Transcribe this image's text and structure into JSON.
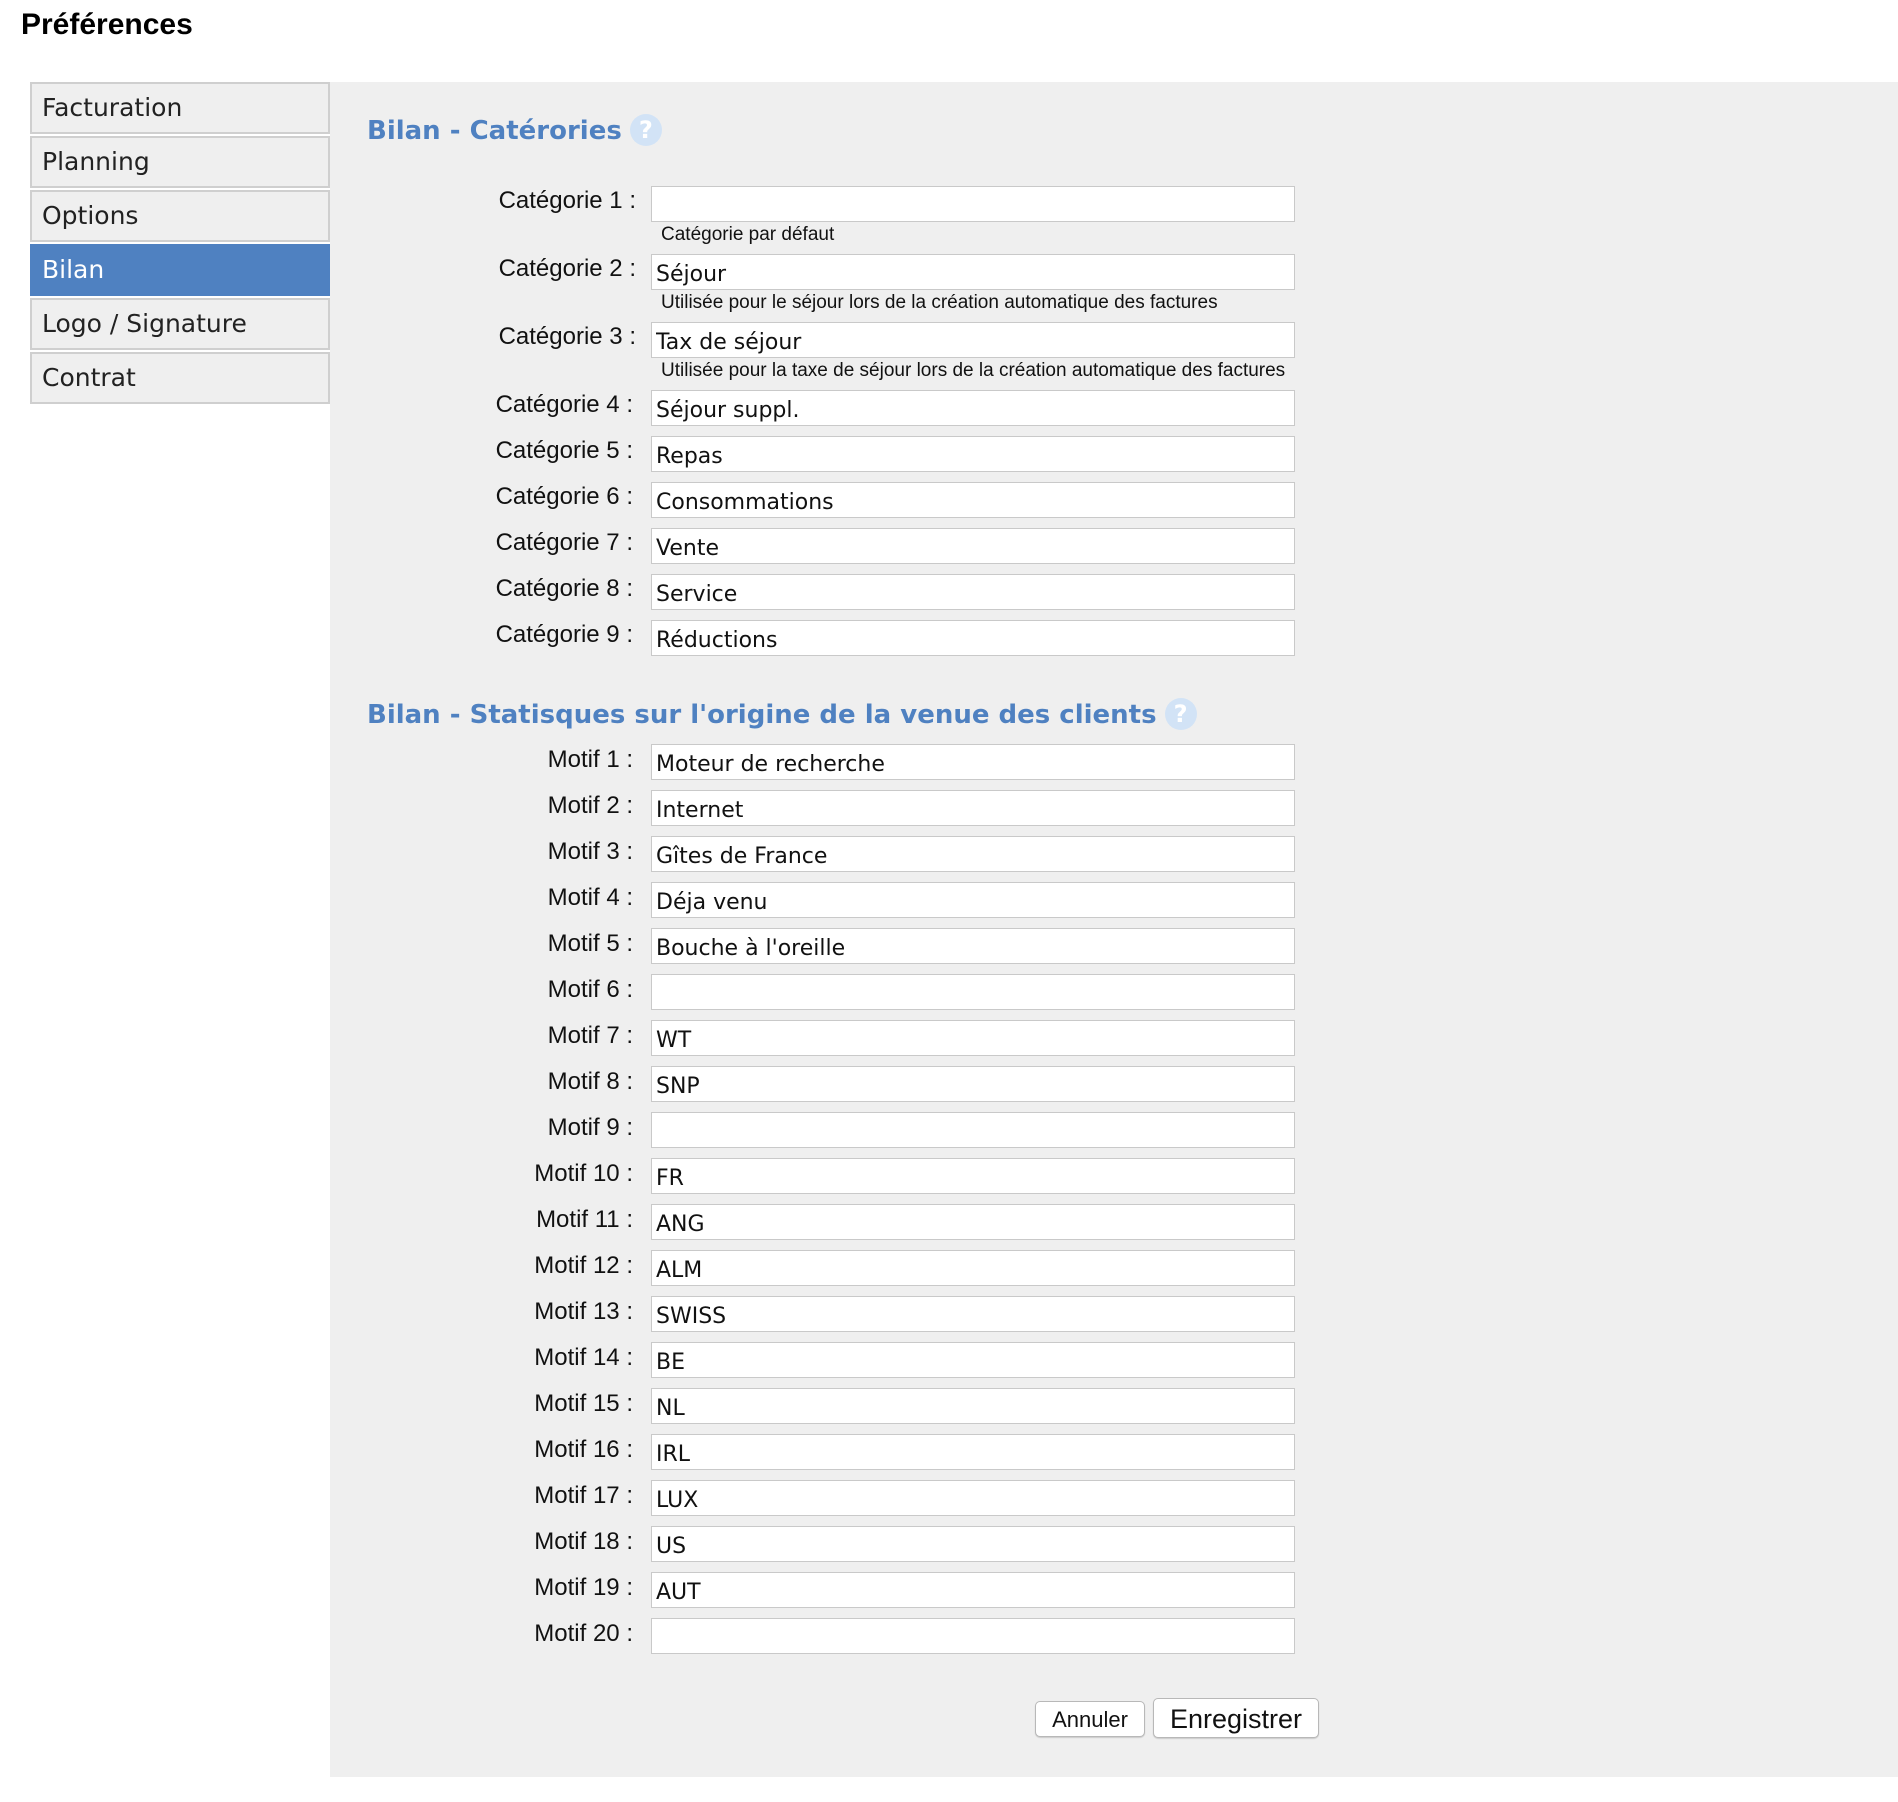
{
  "page": {
    "title": "Préférences"
  },
  "sidebar": {
    "items": [
      {
        "label": "Facturation",
        "active": false
      },
      {
        "label": "Planning",
        "active": false
      },
      {
        "label": "Options",
        "active": false
      },
      {
        "label": "Bilan",
        "active": true
      },
      {
        "label": "Logo / Signature",
        "active": false
      },
      {
        "label": "Contrat",
        "active": false
      }
    ]
  },
  "colors": {
    "accent": "#4f81c1",
    "panel_bg": "#efefef",
    "help_icon": "#d2e3f6"
  },
  "categories": {
    "title": "Bilan - Catérories",
    "help_icon": "question-circle-icon",
    "fields": [
      {
        "label": "Catégorie 1 :",
        "value": "",
        "help": "Catégorie par défaut"
      },
      {
        "label": "Catégorie 2 :",
        "value": "Séjour",
        "help": "Utilisée pour le séjour lors de la création automatique des factures"
      },
      {
        "label": "Catégorie 3 :",
        "value": "Tax de séjour",
        "help": "Utilisée pour la taxe de séjour lors de la création automatique des factures"
      },
      {
        "label": "Catégorie 4 :",
        "value": "Séjour suppl."
      },
      {
        "label": "Catégorie 5 :",
        "value": "Repas"
      },
      {
        "label": "Catégorie 6 :",
        "value": "Consommations"
      },
      {
        "label": "Catégorie 7 :",
        "value": "Vente"
      },
      {
        "label": "Catégorie 8 :",
        "value": "Service"
      },
      {
        "label": "Catégorie 9 :",
        "value": "Réductions"
      }
    ]
  },
  "origins": {
    "title": "Bilan - Statisques sur l'origine de la venue des clients",
    "help_icon": "question-circle-icon",
    "fields": [
      {
        "label": "Motif 1 :",
        "value": "Moteur de recherche"
      },
      {
        "label": "Motif 2 :",
        "value": "Internet"
      },
      {
        "label": "Motif 3 :",
        "value": "Gîtes de France"
      },
      {
        "label": "Motif 4 :",
        "value": "Déja venu"
      },
      {
        "label": "Motif 5 :",
        "value": "Bouche à l'oreille"
      },
      {
        "label": "Motif 6 :",
        "value": ""
      },
      {
        "label": "Motif 7 :",
        "value": "WT"
      },
      {
        "label": "Motif 8 :",
        "value": "SNP"
      },
      {
        "label": "Motif 9 :",
        "value": ""
      },
      {
        "label": "Motif 10 :",
        "value": "FR"
      },
      {
        "label": "Motif 11 :",
        "value": "ANG"
      },
      {
        "label": "Motif 12 :",
        "value": "ALM"
      },
      {
        "label": "Motif 13 :",
        "value": "SWISS"
      },
      {
        "label": "Motif 14 :",
        "value": "BE"
      },
      {
        "label": "Motif 15 :",
        "value": "NL"
      },
      {
        "label": "Motif 16 :",
        "value": "IRL"
      },
      {
        "label": "Motif 17 :",
        "value": "LUX"
      },
      {
        "label": "Motif 18 :",
        "value": "US"
      },
      {
        "label": "Motif 19 :",
        "value": "AUT"
      },
      {
        "label": "Motif 20 :",
        "value": ""
      }
    ]
  },
  "actions": {
    "cancel_label": "Annuler",
    "save_label": "Enregistrer"
  }
}
